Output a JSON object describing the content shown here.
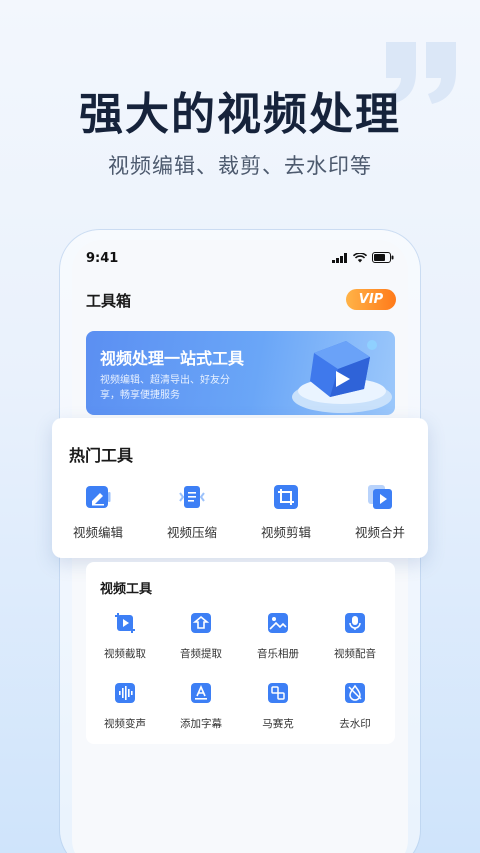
{
  "headline": "强大的视频处理",
  "subline": "视频编辑、裁剪、去水印等",
  "status_bar": {
    "time": "9:41"
  },
  "header": {
    "title": "工具箱",
    "vip_label": "VIP"
  },
  "banner": {
    "title": "视频处理一站式工具",
    "description": "视频编辑、超清导出、好友分享，畅享便捷服务"
  },
  "hot_tools": {
    "title": "热门工具",
    "items": [
      {
        "label": "视频编辑",
        "icon": "edit-icon"
      },
      {
        "label": "视频压缩",
        "icon": "compress-icon"
      },
      {
        "label": "视频剪辑",
        "icon": "crop-icon"
      },
      {
        "label": "视频合并",
        "icon": "merge-icon"
      }
    ]
  },
  "video_tools": {
    "title": "视频工具",
    "items": [
      {
        "label": "视频截取",
        "icon": "trim-icon"
      },
      {
        "label": "音频提取",
        "icon": "audio-extract-icon"
      },
      {
        "label": "音乐相册",
        "icon": "music-album-icon"
      },
      {
        "label": "视频配音",
        "icon": "microphone-icon"
      },
      {
        "label": "视频变声",
        "icon": "voice-wave-icon"
      },
      {
        "label": "添加字幕",
        "icon": "subtitle-icon"
      },
      {
        "label": "马赛克",
        "icon": "mosaic-icon"
      },
      {
        "label": "去水印",
        "icon": "remove-watermark-icon"
      }
    ]
  },
  "colors": {
    "accent": "#3d7ff5",
    "vip": "#ff8a24",
    "headline": "#16233b"
  }
}
